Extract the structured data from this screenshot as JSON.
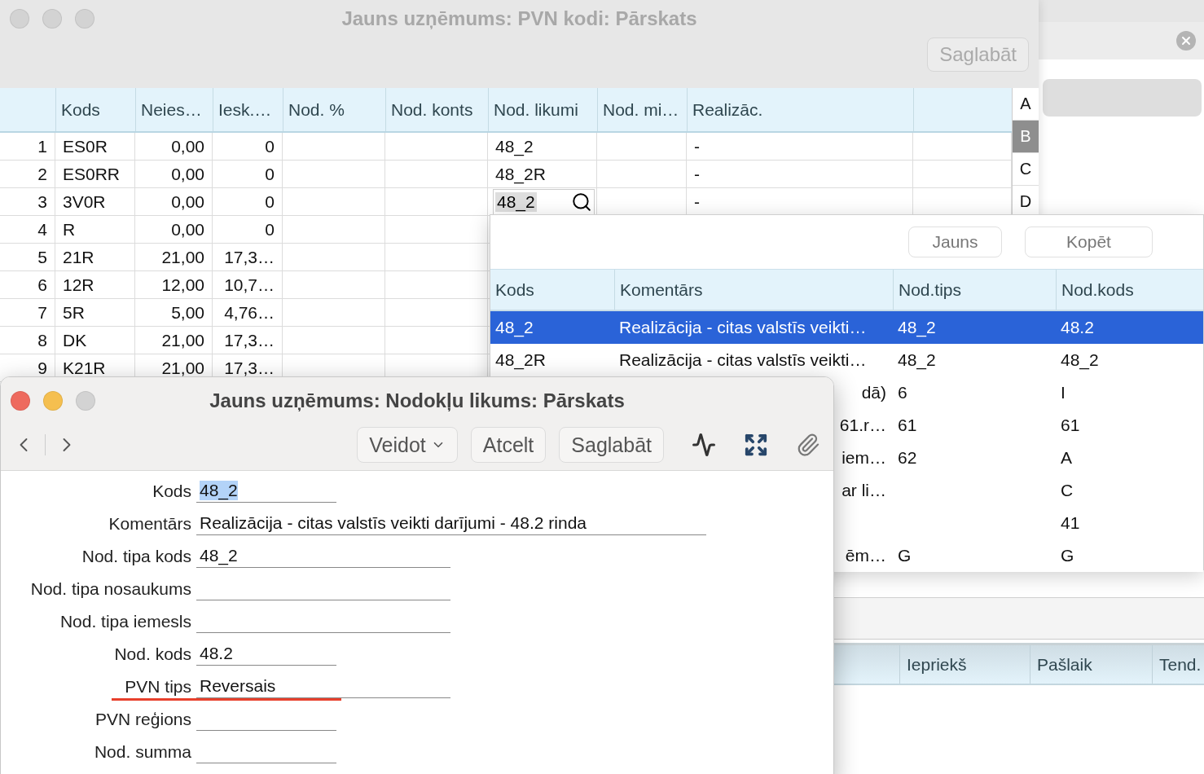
{
  "background_window": {
    "columns": [
      "Iepriekš",
      "Pašlaik",
      "Tend."
    ]
  },
  "main_window": {
    "title": "Jauns uzņēmums: PVN kodi: Pārskats",
    "active": false,
    "save_button": {
      "label": "Saglabāt",
      "disabled": true
    },
    "table": {
      "columns": [
        "Kods",
        "Neies…",
        "Iesk.…",
        "Nod. %",
        "Nod. konts",
        "Nod. likumi",
        "Nod. mi…",
        "Realizāc."
      ],
      "rows": [
        {
          "number": "1",
          "kods": "ES0R",
          "neies": "0,00",
          "iesk": "0",
          "nod_likumi": "48_2",
          "realizac": "-",
          "editing": false
        },
        {
          "number": "2",
          "kods": "ES0RR",
          "neies": "0,00",
          "iesk": "0",
          "nod_likumi": "48_2R",
          "realizac": "-",
          "editing": false
        },
        {
          "number": "3",
          "kods": "3V0R",
          "neies": "0,00",
          "iesk": "0",
          "nod_likumi": "48_2",
          "realizac": "-",
          "editing": true
        },
        {
          "number": "4",
          "kods": "R",
          "neies": "0,00",
          "iesk": "0",
          "editing": false
        },
        {
          "number": "5",
          "kods": "21R",
          "neies": "21,00",
          "iesk": "17,3…",
          "editing": false
        },
        {
          "number": "6",
          "kods": "12R",
          "neies": "12,00",
          "iesk": "10,7…",
          "editing": false
        },
        {
          "number": "7",
          "kods": "5R",
          "neies": "5,00",
          "iesk": "4,76…",
          "editing": false
        },
        {
          "number": "8",
          "kods": "DK",
          "neies": "21,00",
          "iesk": "17,3…",
          "editing": false
        },
        {
          "number": "9",
          "kods": "K21R",
          "neies": "21,00",
          "iesk": "17,3…",
          "editing": false
        }
      ]
    },
    "index": [
      {
        "letter": "A",
        "selected": false
      },
      {
        "letter": "B",
        "selected": true
      },
      {
        "letter": "C",
        "selected": false
      },
      {
        "letter": "D",
        "selected": false
      }
    ]
  },
  "lookup_popup": {
    "buttons": [
      "Jauns",
      "Kopēt"
    ],
    "columns": [
      "Kods",
      "Komentārs",
      "Nod.tips",
      "Nod.kods"
    ],
    "rows": [
      {
        "kods": "48_2",
        "komentars": "Realizācija - citas valstīs veikti…",
        "nod_tips": "48_2",
        "nod_kods": "48.2",
        "selected": true
      },
      {
        "kods": "48_2R",
        "komentars": "Realizācija - citas valstīs veikti…",
        "nod_tips": "48_2",
        "nod_kods": "48_2",
        "selected": false
      },
      {
        "komentars": "dā)",
        "nod_tips": "6",
        "nod_kods": "I",
        "selected": false
      },
      {
        "komentars": "61.r…",
        "nod_tips": "61",
        "nod_kods": "61",
        "selected": false
      },
      {
        "komentars": "iem…",
        "nod_tips": "62",
        "nod_kods": "A",
        "selected": false
      },
      {
        "komentars": "ar li…",
        "nod_kods": "C",
        "selected": false
      },
      {
        "nod_kods": "41",
        "selected": false
      },
      {
        "komentars": "ēm…",
        "nod_tips": "G",
        "nod_kods": "G",
        "selected": false
      }
    ]
  },
  "detail_window": {
    "title": "Jauns uzņēmums: Nodokļu likums: Pārskats",
    "active": true,
    "toolbar": [
      {
        "label": "Veidot",
        "kind": "dropdown"
      },
      {
        "label": "Atcelt",
        "kind": "button"
      },
      {
        "label": "Saglabāt",
        "kind": "button"
      }
    ],
    "fields": [
      {
        "label": "Kods",
        "value": "48_2",
        "highlighted": true,
        "error": false
      },
      {
        "label": "Komentārs",
        "value": "Realizācija - citas valstīs veikti darījumi - 48.2 rinda",
        "highlighted": false,
        "error": false
      },
      {
        "label": "Nod. tipa kods",
        "value": "48_2",
        "highlighted": false,
        "error": false
      },
      {
        "label": "Nod. tipa nosaukums",
        "highlighted": false,
        "error": false
      },
      {
        "label": "Nod. tipa iemesls",
        "highlighted": false,
        "error": false
      },
      {
        "label": "Nod. kods",
        "value": "48.2",
        "highlighted": false,
        "error": false
      },
      {
        "label": "PVN tips",
        "value": "Reversais",
        "highlighted": false,
        "error": true
      },
      {
        "label": "PVN reģions",
        "highlighted": false,
        "error": false
      },
      {
        "label": "Nod. summa",
        "highlighted": false,
        "error": false
      }
    ]
  }
}
